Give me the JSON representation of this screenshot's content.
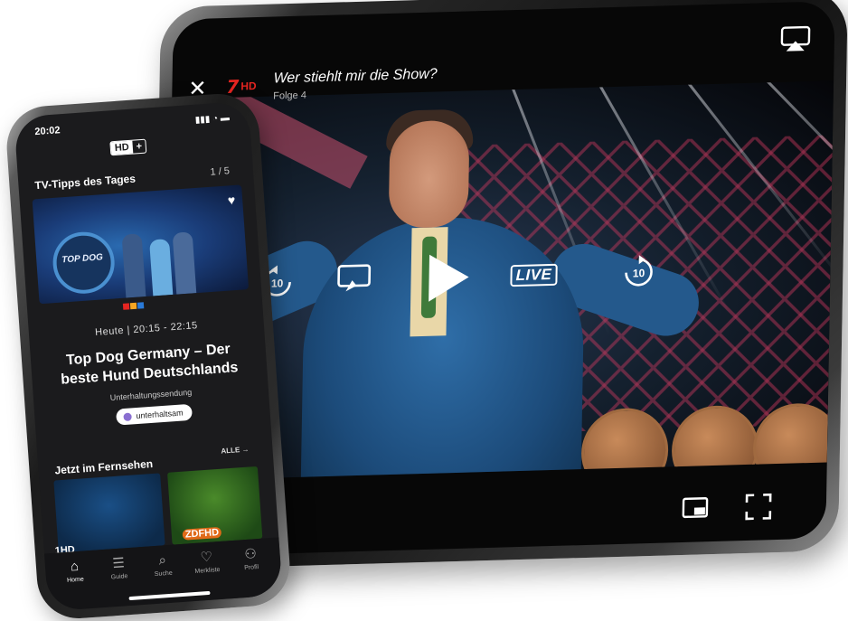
{
  "tablet": {
    "channel_logo": "7",
    "channel_hd": "HD",
    "title": "Wer stiehlt mir die Show?",
    "subtitle": "Folge 4",
    "close_icon": "close-icon",
    "airplay_icon": "airplay-icon",
    "controls": {
      "rewind_label": "10",
      "forward_label": "10",
      "live_label": "LIVE"
    }
  },
  "phone": {
    "status_time": "20:02",
    "status_icons": "▮▮▮ ◔ ▬",
    "brand_hd": "HD",
    "brand_plus": "+",
    "tipps_title": "TV-Tipps des Tages",
    "tipps_counter": "1 / 5",
    "thumb_text": "TOP DOG",
    "time_range": "Heute | 20:15 - 22:15",
    "show_title": "Top Dog Germany – Der beste Hund Deutschlands",
    "genre": "Unterhaltungssendung",
    "mood_label": "unterhaltsam",
    "now_title": "Jetzt im Fernsehen",
    "all_link": "ALLE →",
    "channel_logo_1": "1HD",
    "channel_logo_2": "ZDFHD",
    "tabs": [
      {
        "label": "Home",
        "icon": "⌂"
      },
      {
        "label": "Guide",
        "icon": "☰"
      },
      {
        "label": "Suche",
        "icon": "⌕"
      },
      {
        "label": "Merkliste",
        "icon": "♡"
      },
      {
        "label": "Profil",
        "icon": "⚇"
      }
    ]
  },
  "colors": {
    "channel_red": "#e52521",
    "mood_purple": "#8a6fd1",
    "zdf_orange": "#e06a18"
  }
}
